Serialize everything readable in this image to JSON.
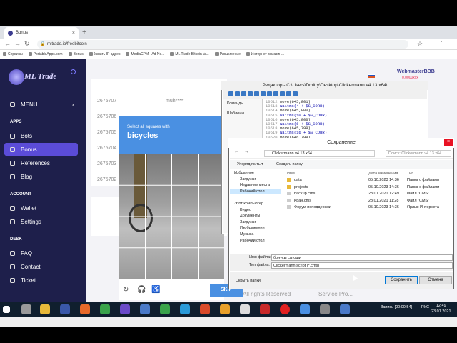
{
  "browser": {
    "tab_title": "Bonus",
    "url": "mltrade.io/freebitcoin",
    "bookmarks": [
      "Сервисы",
      "PortableApps.com",
      "Bonus",
      "Узнать IP адрес",
      "MediaCPM - Ad Ne...",
      "ML Trade Bitcoin Ar...",
      "Расширение",
      "Интернет-магазин..."
    ]
  },
  "site": {
    "logo": "ML Trade",
    "user": "WebmasterBBB",
    "balance": "0.0000xxx",
    "menu": [
      {
        "label": "MENU",
        "icon": "home-icon"
      }
    ],
    "apps_heading": "APPS",
    "apps": [
      "Bots",
      "Bonus",
      "References",
      "Blog"
    ],
    "account_heading": "ACCOUNT",
    "account": [
      "Wallet",
      "Settings"
    ],
    "desk_heading": "DESK",
    "desk": [
      "FAQ",
      "Contact",
      "Ticket"
    ],
    "rows": [
      "2675707",
      "2675706",
      "2675705",
      "2675704",
      "2675703",
      "2675702"
    ],
    "masked": "muh****",
    "footer": "All rights Reserved",
    "footer2": "Service Pro..."
  },
  "captcha": {
    "subtitle": "Select all squares with",
    "object": "bicycles",
    "button": "SKIP"
  },
  "editor": {
    "title": "Редактор - C:\\Users\\Dmitry\\Desktop\\Clickermann v4.13 x64\\",
    "side": [
      "Команды",
      "Шаблоны"
    ],
    "lines": [
      {
        "n": "10512",
        "t": "move(645,801)"
      },
      {
        "n": "10513",
        "t": "waitms(4 + $S_CORR)"
      },
      {
        "n": "10514",
        "t": "move(645,800)"
      },
      {
        "n": "10515",
        "t": "waitms(10 + $S_CORR)"
      },
      {
        "n": "10516",
        "t": "move(645,800)"
      },
      {
        "n": "10517",
        "t": "waitms(6 + $S_CORR)"
      },
      {
        "n": "10518",
        "t": "move(645,799)"
      },
      {
        "n": "10519",
        "t": "waitms(16 + $S_CORR)"
      },
      {
        "n": "10520",
        "t": "move(646,798)"
      }
    ]
  },
  "dialog": {
    "title": "Сохранение",
    "path": "Clickermann v4.13 x64",
    "search": "Поиск: Clickermann v4.13 x64",
    "organize": "Упорядочить ▾",
    "new_folder": "Создать папку",
    "tree": [
      "Избранное",
      "Загрузки",
      "Недавние места",
      "Рабочий стол",
      "",
      "Этот компьютер",
      "Видео",
      "Документы",
      "Загрузки",
      "Изображения",
      "Музыка",
      "Рабочий стол"
    ],
    "cols": [
      "Имя",
      "Дата изменения",
      "Тип"
    ],
    "files": [
      {
        "name": "data",
        "date": "05.10.2023 14:36",
        "type": "Папка с файлами"
      },
      {
        "name": "projects",
        "date": "05.10.2023 14:36",
        "type": "Папка с файлами"
      },
      {
        "name": "backup.cms",
        "date": "23.01.2021 12:49",
        "type": "Файл \"CMS\""
      },
      {
        "name": "Кран.cms",
        "date": "23.01.2021 11:28",
        "type": "Файл \"CMS\""
      },
      {
        "name": "Форум поподдержки",
        "date": "05.10.2023 14:36",
        "type": "Ярлык Интернета"
      }
    ],
    "filename_label": "Имя файла:",
    "filename": "бонусы сатоши",
    "filetype_label": "Тип файла:",
    "filetype": "Clickermann script (*.cms)",
    "hide": "Скрыть папки",
    "save": "Сохранить",
    "cancel": "Отмена"
  },
  "taskbar": {
    "lang": "РУС",
    "rec": "Запись [00:00:54]",
    "time": "12:49",
    "date": "23.01.2021"
  }
}
